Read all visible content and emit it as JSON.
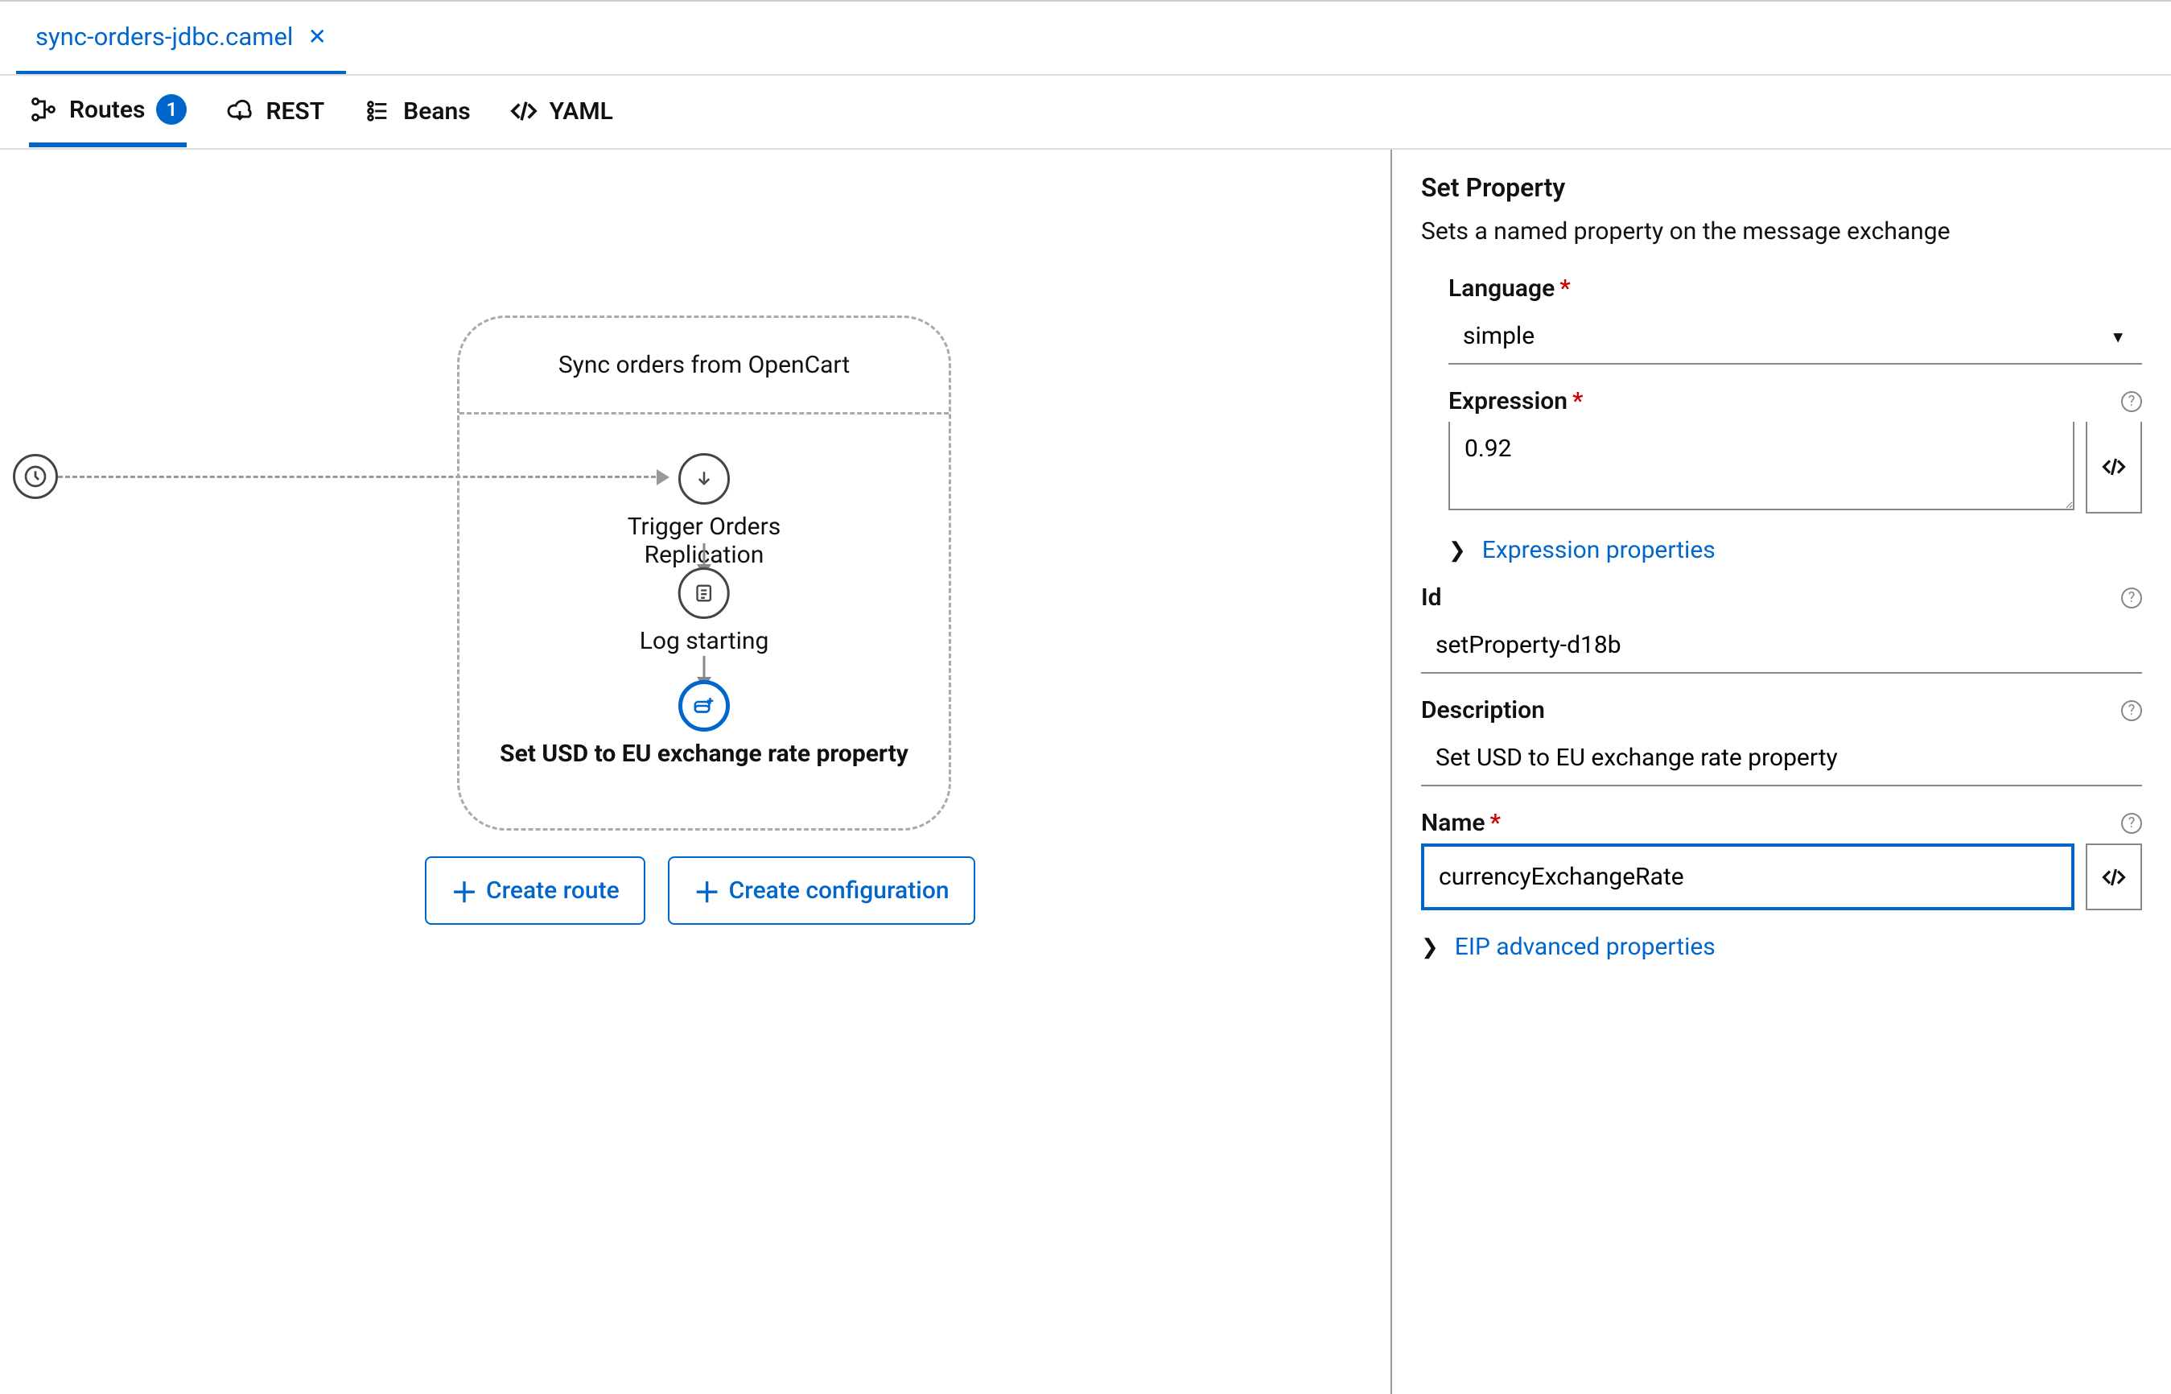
{
  "file_tab": {
    "name": "sync-orders-jdbc.camel"
  },
  "view_tabs": {
    "routes": {
      "label": "Routes",
      "badge": "1"
    },
    "rest": {
      "label": "REST"
    },
    "beans": {
      "label": "Beans"
    },
    "yaml": {
      "label": "YAML"
    }
  },
  "canvas": {
    "route_title": "Sync orders from OpenCart",
    "nodes": {
      "trigger": "Trigger Orders Replication",
      "log": "Log starting",
      "setprop": "Set USD to EU exchange rate property"
    },
    "buttons": {
      "create_route": "Create route",
      "create_config": "Create configuration"
    }
  },
  "panel": {
    "title": "Set Property",
    "description": "Sets a named property on the message exchange",
    "fields": {
      "language": {
        "label": "Language",
        "value": "simple"
      },
      "expression": {
        "label": "Expression",
        "value": "0.92"
      },
      "expression_props": "Expression properties",
      "id": {
        "label": "Id",
        "value": "setProperty-d18b"
      },
      "description": {
        "label": "Description",
        "value": "Set USD to EU exchange rate property"
      },
      "name": {
        "label": "Name",
        "value": "currencyExchangeRate"
      },
      "eip_advanced": "EIP advanced properties"
    }
  }
}
